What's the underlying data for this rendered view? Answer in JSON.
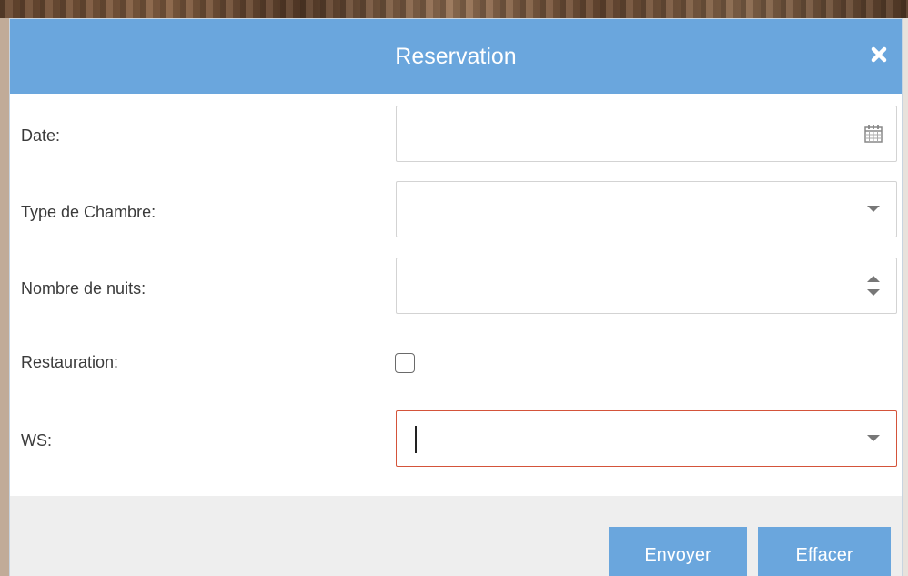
{
  "dialog": {
    "title": "Reservation",
    "close_icon": "close-icon",
    "accent_color": "#6aa6dd"
  },
  "form": {
    "date": {
      "label": "Date:",
      "value": "",
      "icon": "calendar-icon"
    },
    "room_type": {
      "label": "Type de Chambre:",
      "value": "",
      "icon": "chevron-down-icon"
    },
    "nights": {
      "label": "Nombre de nuits:",
      "value": "",
      "icon": "stepper-icon"
    },
    "catering": {
      "label": "Restauration:",
      "checked": false
    },
    "ws": {
      "label": "WS:",
      "value": "",
      "icon": "chevron-down-icon",
      "invalid": true,
      "invalid_color": "#d4543a"
    }
  },
  "footer": {
    "submit_label": "Envoyer",
    "clear_label": "Effacer"
  }
}
